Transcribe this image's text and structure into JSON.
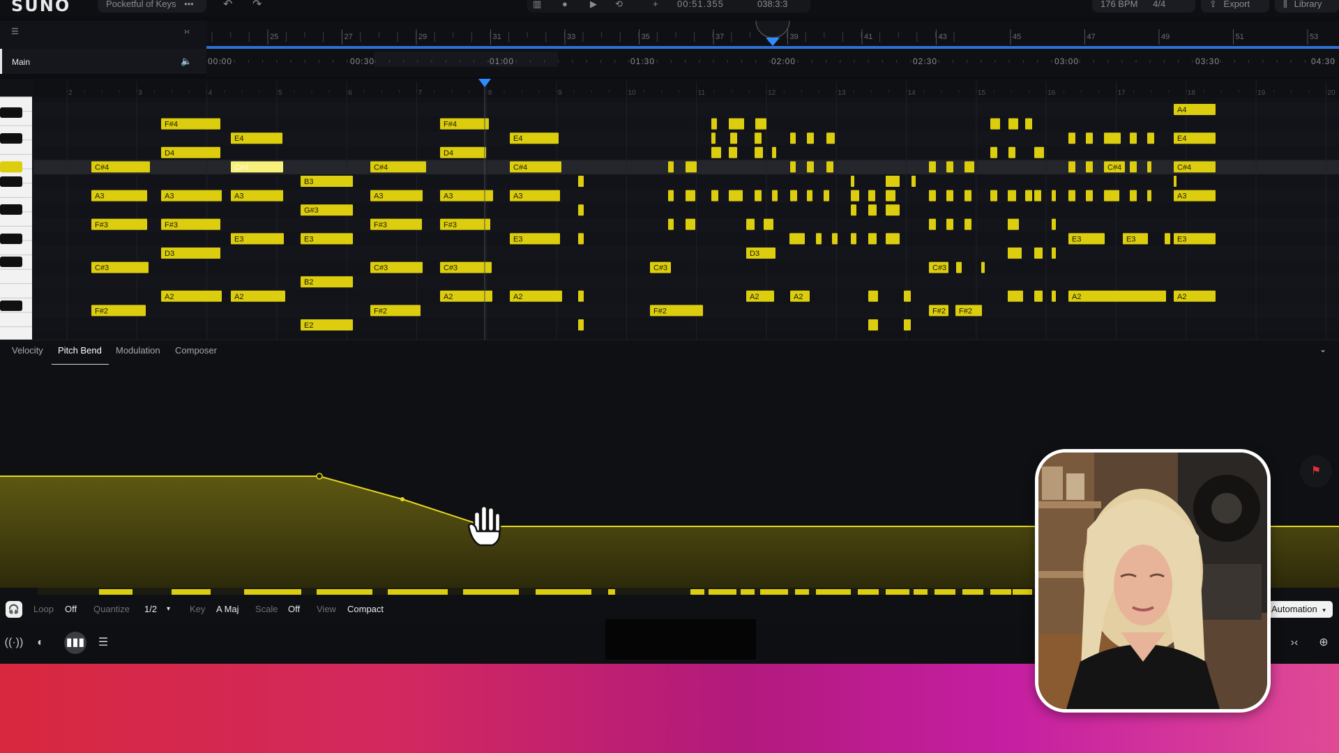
{
  "app": {
    "logo": "SUNO",
    "project_name": "Pocketful of Keys",
    "project_more": "•••"
  },
  "transport": {
    "time": "00:51.355",
    "position": "038:3:3",
    "bpm": "176 BPM",
    "meter": "4/4",
    "export_label": "Export",
    "library_label": "Library"
  },
  "track": {
    "name": "Main"
  },
  "ruler": {
    "bars": [
      "25",
      "27",
      "29",
      "31",
      "33",
      "35",
      "37",
      "39",
      "41",
      "43",
      "45",
      "47",
      "49",
      "51",
      "53"
    ],
    "times": [
      "00:00",
      "00:30",
      "01:00",
      "01:30",
      "02:00",
      "02:30",
      "03:00",
      "03:30",
      "04:30"
    ]
  },
  "roll": {
    "beat_numbers": [
      "2",
      "3",
      "4",
      "5",
      "6",
      "7",
      "8",
      "9",
      "10",
      "11",
      "12",
      "13",
      "14",
      "15",
      "16",
      "17",
      "18",
      "19",
      "20"
    ],
    "notes": [
      {
        "label": "F#4",
        "row": "F#4",
        "start": 0.125,
        "len": 0.08
      },
      {
        "label": "E4",
        "row": "E4",
        "start": 0.175,
        "len": 0.07
      },
      {
        "label": "D4",
        "row": "D4",
        "start": 0.125,
        "len": 0.08
      },
      {
        "label": "C#4",
        "row": "C#4",
        "start": 0.066,
        "len": 0.08
      },
      {
        "label": "C#4",
        "row": "C#4",
        "start": 0.175,
        "len": 0.075,
        "selected": true
      },
      {
        "label": "B3",
        "row": "B3",
        "start": 0.226,
        "len": 0.07
      },
      {
        "label": "A3",
        "row": "A3",
        "start": 0.066,
        "len": 0.08
      },
      {
        "label": "A3",
        "row": "A3",
        "start": 0.125,
        "len": 0.08
      },
      {
        "label": "A3",
        "row": "A3",
        "start": 0.175,
        "len": 0.07
      },
      {
        "label": "G#3",
        "row": "G#3",
        "start": 0.226,
        "len": 0.07
      },
      {
        "label": "F#3",
        "row": "F#3",
        "start": 0.066,
        "len": 0.08
      },
      {
        "label": "F#3",
        "row": "F#3",
        "start": 0.125,
        "len": 0.08
      },
      {
        "label": "E3",
        "row": "E3",
        "start": 0.175,
        "len": 0.07
      },
      {
        "label": "E3",
        "row": "E3",
        "start": 0.226,
        "len": 0.07
      },
      {
        "label": "D3",
        "row": "D3",
        "start": 0.125,
        "len": 0.08
      },
      {
        "label": "C#3",
        "row": "C#3",
        "start": 0.066,
        "len": 0.08
      },
      {
        "label": "B2",
        "row": "B2",
        "start": 0.226,
        "len": 0.07
      },
      {
        "label": "A2",
        "row": "A2",
        "start": 0.125,
        "len": 0.08
      },
      {
        "label": "A2",
        "row": "A2",
        "start": 0.175,
        "len": 0.07
      },
      {
        "label": "F#2",
        "row": "F#2",
        "start": 0.066,
        "len": 0.08
      },
      {
        "label": "E2",
        "row": "E2",
        "start": 0.226,
        "len": 0.07
      }
    ]
  },
  "lower_tabs": {
    "velocity": "Velocity",
    "pitch_bend": "Pitch Bend",
    "modulation": "Modulation",
    "composer": "Composer"
  },
  "toolbar": {
    "loop_label": "Loop",
    "loop_value": "Off",
    "quantize_label": "Quantize",
    "quantize_value": "1/2",
    "key_label": "Key",
    "key_value": "A Maj",
    "scale_label": "Scale",
    "scale_value": "Off",
    "view_label": "View",
    "view_value": "Compact",
    "automation_label": "Automation"
  },
  "colors": {
    "note": "#dccd0e",
    "note_selected": "#f7f07a",
    "accent_blue": "#2f8cff",
    "pitch_line": "#e5d820"
  },
  "icons": [
    "headphones-icon",
    "undo-icon",
    "redo-icon",
    "record-icon",
    "play-icon",
    "loop-icon",
    "metronome-icon",
    "export-icon",
    "library-icon",
    "flag-icon",
    "zoom-icon",
    "broadcast-icon",
    "contrast-icon",
    "waveform-icon",
    "list-icon",
    "collapse-icon"
  ]
}
